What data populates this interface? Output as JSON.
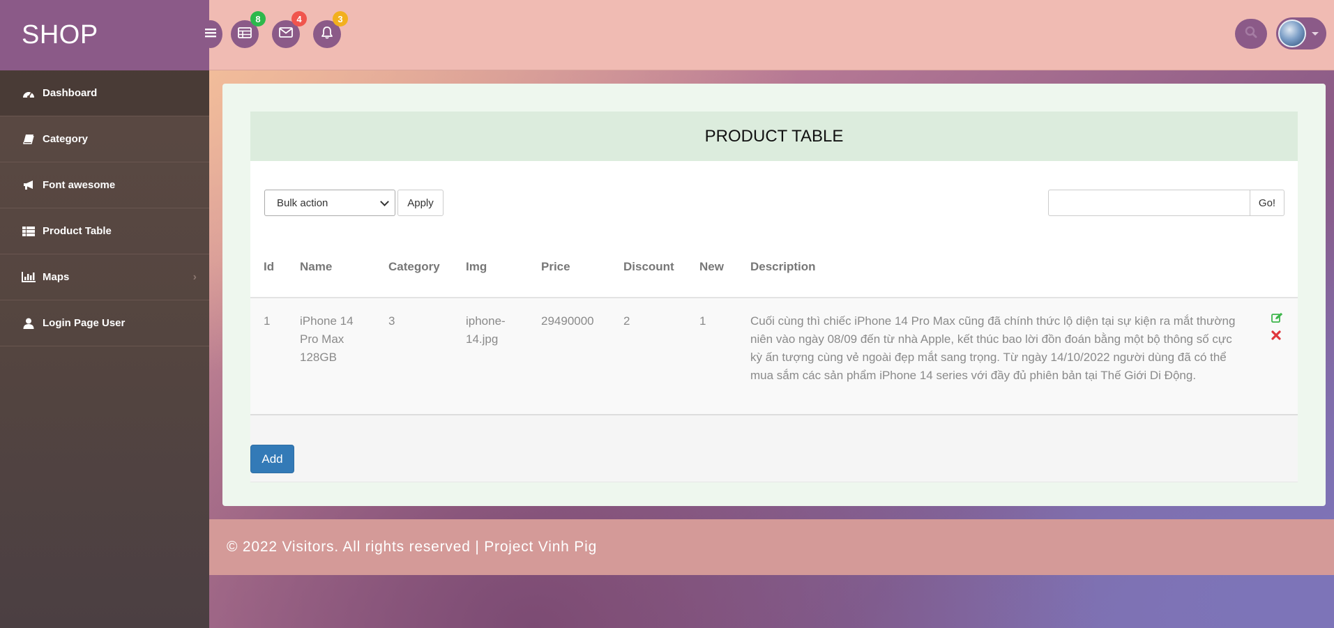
{
  "brand": "SHOP",
  "sidebar": {
    "items": [
      {
        "label": "Dashboard"
      },
      {
        "label": "Category"
      },
      {
        "label": "Font awesome"
      },
      {
        "label": "Product Table"
      },
      {
        "label": "Maps"
      },
      {
        "label": "Login Page User"
      }
    ]
  },
  "header": {
    "badges": {
      "tasks": "8",
      "messages": "4",
      "notifications": "3"
    },
    "colors": {
      "tasks": "#2db84c",
      "messages": "#f0554d",
      "notifications": "#f2b01e"
    }
  },
  "product_table": {
    "title": "PRODUCT TABLE",
    "bulk_action": "Bulk action",
    "apply_label": "Apply",
    "search_placeholder": "",
    "go_label": "Go!",
    "columns": [
      "Id",
      "Name",
      "Category",
      "Img",
      "Price",
      "Discount",
      "New",
      "Description"
    ],
    "rows": [
      {
        "id": "1",
        "name": "iPhone 14 Pro Max 128GB",
        "category": "3",
        "img": "iphone-14.jpg",
        "price": "29490000",
        "discount": "2",
        "new": "1",
        "description": "Cuối cùng thì chiếc iPhone 14 Pro Max cũng đã chính thức lộ diện tại sự kiện ra mắt thường niên vào ngày 08/09 đến từ nhà Apple, kết thúc bao lời đồn đoán bằng một bộ thông số cực kỳ ấn tượng cùng vẻ ngoài đẹp mắt sang trọng. Từ ngày 14/10/2022 người dùng đã có thể mua sắm các sản phẩm iPhone 14 series với đầy đủ phiên bản tại Thế Giới Di Động."
      }
    ],
    "add_label": "Add"
  },
  "footer": {
    "text": "© 2022 Visitors. All rights reserved | Project Vinh Pig"
  }
}
